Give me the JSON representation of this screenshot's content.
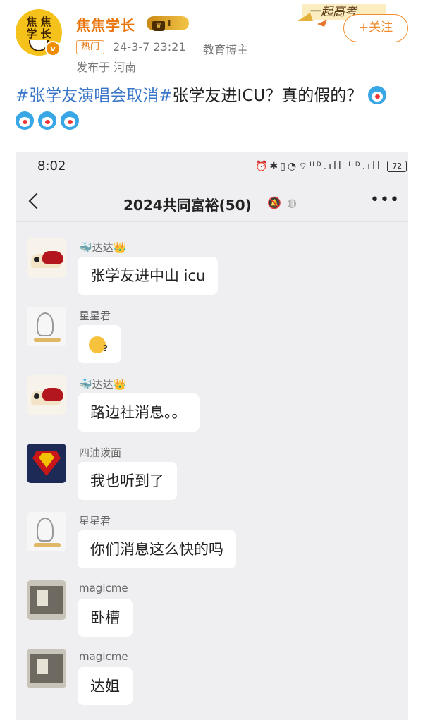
{
  "post": {
    "avatar_text": [
      "焦",
      "焦",
      "学",
      "长"
    ],
    "verified_mark": "v",
    "author_name": "焦焦学长",
    "level_badge": "I",
    "follow_label": "+关注",
    "banner_text": "一起高考",
    "hot_tag": "热门",
    "date": "24-3-7 23:21",
    "source": "教育博主",
    "location": "发布于 河南",
    "hashtag1": "#张学友演唱会取消#",
    "body_text": "张学友进ICU？真的假的？",
    "emoji_count": 4,
    "icons": {
      "follow": "plus-icon",
      "crown": "crown-icon",
      "verified": "verified-icon",
      "emoji": "doraemon-emoji"
    },
    "colors": {
      "accent": "#e8740a",
      "hashtag": "#3876c7",
      "follow": "#f08c2e"
    }
  },
  "chat": {
    "status_time": "8:02",
    "status_icons_text": "⏰✱▯◔⌔ᴴᴰ.ıll ᴴᴰ.ıll",
    "battery": "72",
    "title": "2024共同富裕(50)",
    "icons": {
      "back": "back-arrow-icon",
      "mute": "bell-off-icon",
      "ear": "ear-icon",
      "more": "more-dots-icon"
    },
    "messages": [
      {
        "sender": "达达",
        "sender_prefix": "🐳",
        "sender_suffix": "👑",
        "text": "张学友进中山 icu",
        "avatar": "cake-avatar"
      },
      {
        "sender": "星星君",
        "text": "",
        "emoji": "puzzled-emoji",
        "avatar": "sketch-avatar"
      },
      {
        "sender": "达达",
        "sender_prefix": "🐳",
        "sender_suffix": "👑",
        "text": "路边社消息。。",
        "avatar": "cake-avatar"
      },
      {
        "sender": "四油泼面",
        "text": "我也听到了",
        "avatar": "superman-avatar"
      },
      {
        "sender": "星星君",
        "text": "你们消息这么快的吗",
        "avatar": "sketch-avatar"
      },
      {
        "sender": "magicme",
        "text": "卧槽",
        "avatar": "photo-avatar"
      },
      {
        "sender": "magicme",
        "text": "达姐",
        "avatar": "photo-avatar"
      }
    ]
  }
}
